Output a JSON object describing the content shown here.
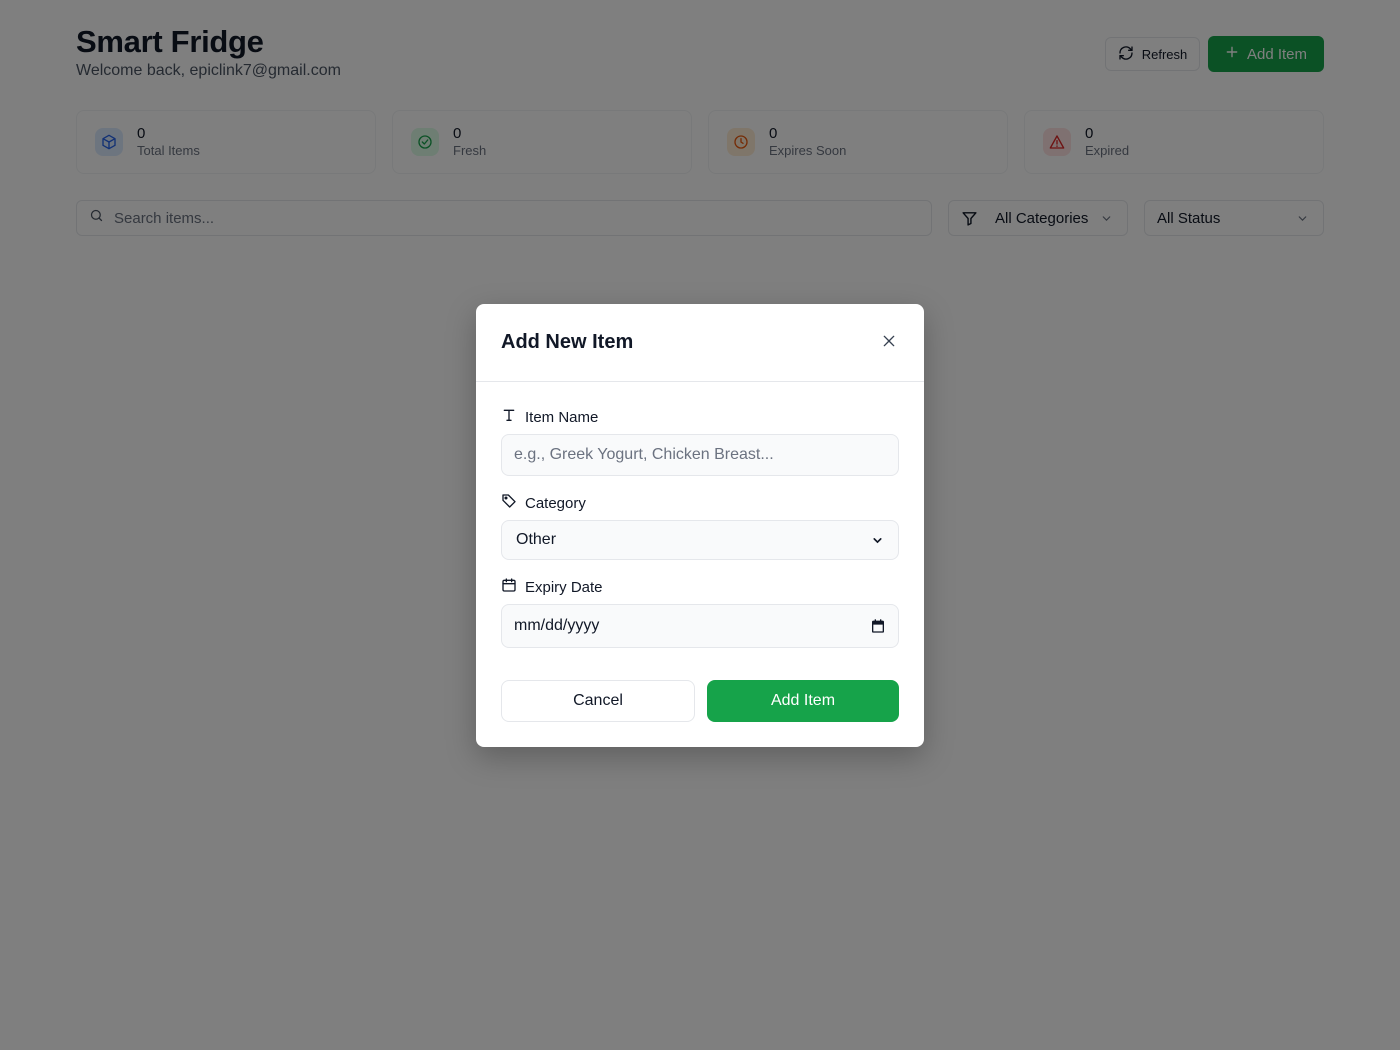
{
  "header": {
    "title": "Smart Fridge",
    "welcome": "Welcome back, epiclink7@gmail.com",
    "refresh_label": "Refresh",
    "add_label": "Add Item"
  },
  "stats": [
    {
      "value": "0",
      "label": "Total Items",
      "icon": "box-icon",
      "color": "#2563eb",
      "bg": "#dbeafe"
    },
    {
      "value": "0",
      "label": "Fresh",
      "icon": "check-circle-icon",
      "color": "#16a34a",
      "bg": "#dcfce7"
    },
    {
      "value": "0",
      "label": "Expires Soon",
      "icon": "clock-icon",
      "color": "#ea580c",
      "bg": "#ffedd5"
    },
    {
      "value": "0",
      "label": "Expired",
      "icon": "alert-triangle-icon",
      "color": "#dc2626",
      "bg": "#fee2e2"
    }
  ],
  "filters": {
    "search_placeholder": "Search items...",
    "category_value": "All Categories",
    "status_value": "All Status"
  },
  "modal": {
    "title": "Add New Item",
    "name_label": "Item Name",
    "name_placeholder": "e.g., Greek Yogurt, Chicken Breast...",
    "category_label": "Category",
    "category_value": "Other",
    "expiry_label": "Expiry Date",
    "expiry_placeholder": "mm/dd/yyyy",
    "cancel_label": "Cancel",
    "submit_label": "Add Item"
  },
  "colors": {
    "accent": "#16a34a",
    "overlay": "rgba(0,0,0,0.5)"
  }
}
